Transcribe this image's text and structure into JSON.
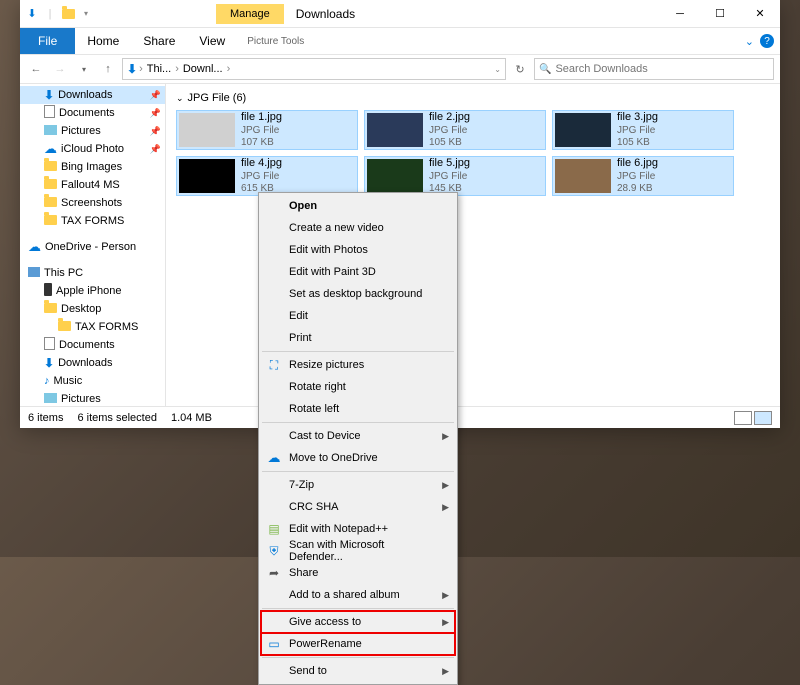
{
  "window": {
    "title": "Downloads",
    "tools_tab": "Manage",
    "tools_label": "Picture Tools"
  },
  "ribbon": {
    "file": "File",
    "home": "Home",
    "share": "Share",
    "view": "View"
  },
  "breadcrumb": {
    "seg1": "Thi...",
    "seg2": "Downl...",
    "refresh": "↻"
  },
  "search": {
    "placeholder": "Search Downloads",
    "icon": "🔍"
  },
  "sidebar": {
    "items": [
      {
        "label": "Downloads",
        "icon": "dl",
        "sel": true,
        "pin": true,
        "lvl": 1
      },
      {
        "label": "Documents",
        "icon": "doc",
        "pin": true,
        "lvl": 1
      },
      {
        "label": "Pictures",
        "icon": "pic",
        "pin": true,
        "lvl": 1
      },
      {
        "label": "iCloud Photo",
        "icon": "cloud",
        "pin": true,
        "lvl": 1
      },
      {
        "label": "Bing Images",
        "icon": "folder",
        "lvl": 1
      },
      {
        "label": "Fallout4 MS",
        "icon": "folder",
        "lvl": 1
      },
      {
        "label": "Screenshots",
        "icon": "folder",
        "lvl": 1
      },
      {
        "label": "TAX FORMS",
        "icon": "folder",
        "lvl": 1
      },
      {
        "gap": true
      },
      {
        "label": "OneDrive - Person",
        "icon": "onedrive",
        "lvl": 0
      },
      {
        "gap": true
      },
      {
        "label": "This PC",
        "icon": "pc",
        "lvl": 0
      },
      {
        "label": "Apple iPhone",
        "icon": "phone",
        "lvl": 1
      },
      {
        "label": "Desktop",
        "icon": "folder",
        "lvl": 1
      },
      {
        "label": "TAX FORMS",
        "icon": "folder",
        "lvl": 2
      },
      {
        "label": "Documents",
        "icon": "doc",
        "lvl": 1
      },
      {
        "label": "Downloads",
        "icon": "dl",
        "lvl": 1
      },
      {
        "label": "Music",
        "icon": "music",
        "lvl": 1
      },
      {
        "label": "Pictures",
        "icon": "pic",
        "lvl": 1
      }
    ]
  },
  "group": {
    "label": "JPG File (6)"
  },
  "files": [
    {
      "name": "file 1.jpg",
      "type": "JPG File",
      "size": "107 KB"
    },
    {
      "name": "file 2.jpg",
      "type": "JPG File",
      "size": "105 KB"
    },
    {
      "name": "file 3.jpg",
      "type": "JPG File",
      "size": "105 KB"
    },
    {
      "name": "file 4.jpg",
      "type": "JPG File",
      "size": "615 KB"
    },
    {
      "name": "file 5.jpg",
      "type": "JPG File",
      "size": "145 KB"
    },
    {
      "name": "file 6.jpg",
      "type": "JPG File",
      "size": "28.9 KB"
    }
  ],
  "status": {
    "count": "6 items",
    "selected": "6 items selected",
    "size": "1.04 MB"
  },
  "context": {
    "open": "Open",
    "newvideo": "Create a new video",
    "photos": "Edit with Photos",
    "paint3d": "Edit with Paint 3D",
    "desktopbg": "Set as desktop background",
    "edit": "Edit",
    "print": "Print",
    "resize": "Resize pictures",
    "rotr": "Rotate right",
    "rotl": "Rotate left",
    "cast": "Cast to Device",
    "onedrive": "Move to OneDrive",
    "zip": "7-Zip",
    "crc": "CRC SHA",
    "npp": "Edit with Notepad++",
    "defender": "Scan with Microsoft Defender...",
    "share": "Share",
    "album": "Add to a shared album",
    "access": "Give access to",
    "power": "PowerRename",
    "sendto": "Send to"
  }
}
